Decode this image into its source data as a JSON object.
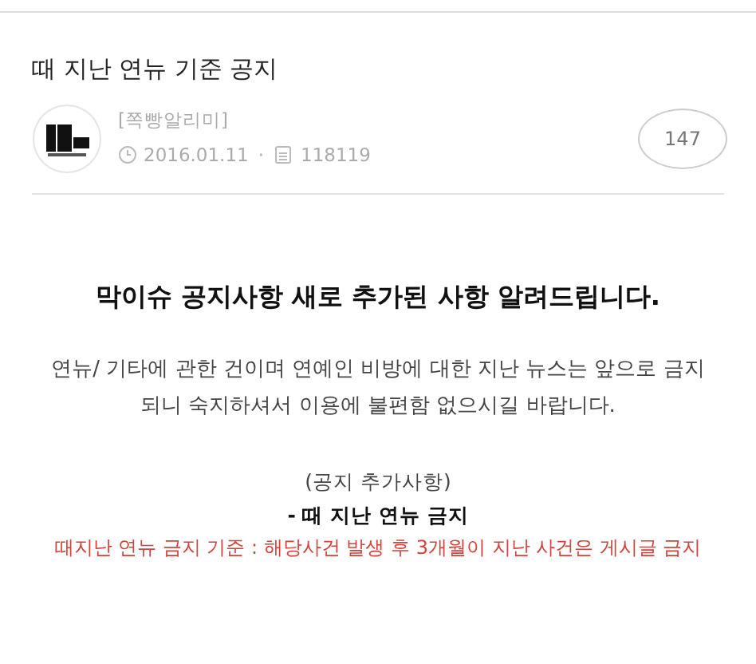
{
  "title": "때 지난 연뉴 기준 공지",
  "meta": {
    "category": "[쪽빵알리미]",
    "date": "2016.01.11",
    "separator": "·",
    "views": "118119",
    "comments": "147"
  },
  "body": [
    {
      "kind": "heading",
      "text": "막이슈 공지사항 새로 추가된 사항 알려드립니다."
    },
    {
      "kind": "paragraph",
      "text": "연뉴/ 기타에 관한 건이며 연예인 비방에 대한 지난 뉴스는 앞으로 금지되니 숙지하셔서 이용에 불편함 없으시길 바랍니다."
    },
    {
      "kind": "note",
      "text": "(공지 추가사항)"
    },
    {
      "kind": "strong",
      "text": "- 때 지난 연뉴 금지"
    },
    {
      "kind": "warning",
      "text": "때지난 연뉴 금지 기준 : 해당사건 발생 후 3개월이 지난 사건은 게시글 금지"
    }
  ]
}
